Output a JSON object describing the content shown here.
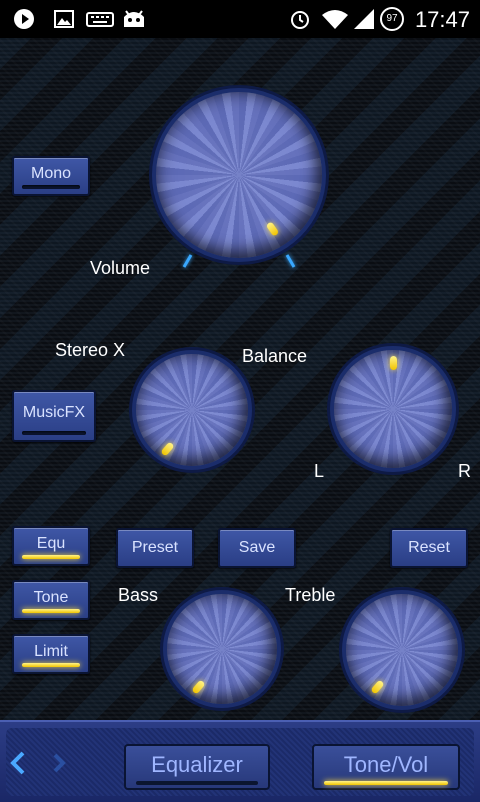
{
  "status_bar": {
    "time": "17:47",
    "battery": "97",
    "icons": [
      "play-icon",
      "image-icon",
      "keyboard-icon",
      "android-icon",
      "alarm-icon",
      "wifi-icon",
      "signal-icon"
    ]
  },
  "knobs": {
    "volume": {
      "label": "Volume"
    },
    "stereo_x": {
      "label": "Stereo X"
    },
    "balance": {
      "label": "Balance",
      "left": "L",
      "right": "R"
    },
    "bass": {
      "label": "Bass"
    },
    "treble": {
      "label": "Treble"
    }
  },
  "buttons": {
    "mono": "Mono",
    "musicfx": "MusicFX",
    "equ": "Equ",
    "tone": "Tone",
    "limit": "Limit",
    "preset": "Preset",
    "save": "Save",
    "reset": "Reset"
  },
  "tabs": {
    "equalizer": "Equalizer",
    "tonevol": "Tone/Vol"
  },
  "colors": {
    "accent": "#f0c400",
    "knob_blue": "#6672bd",
    "tick_blue": "#39a8ff"
  }
}
